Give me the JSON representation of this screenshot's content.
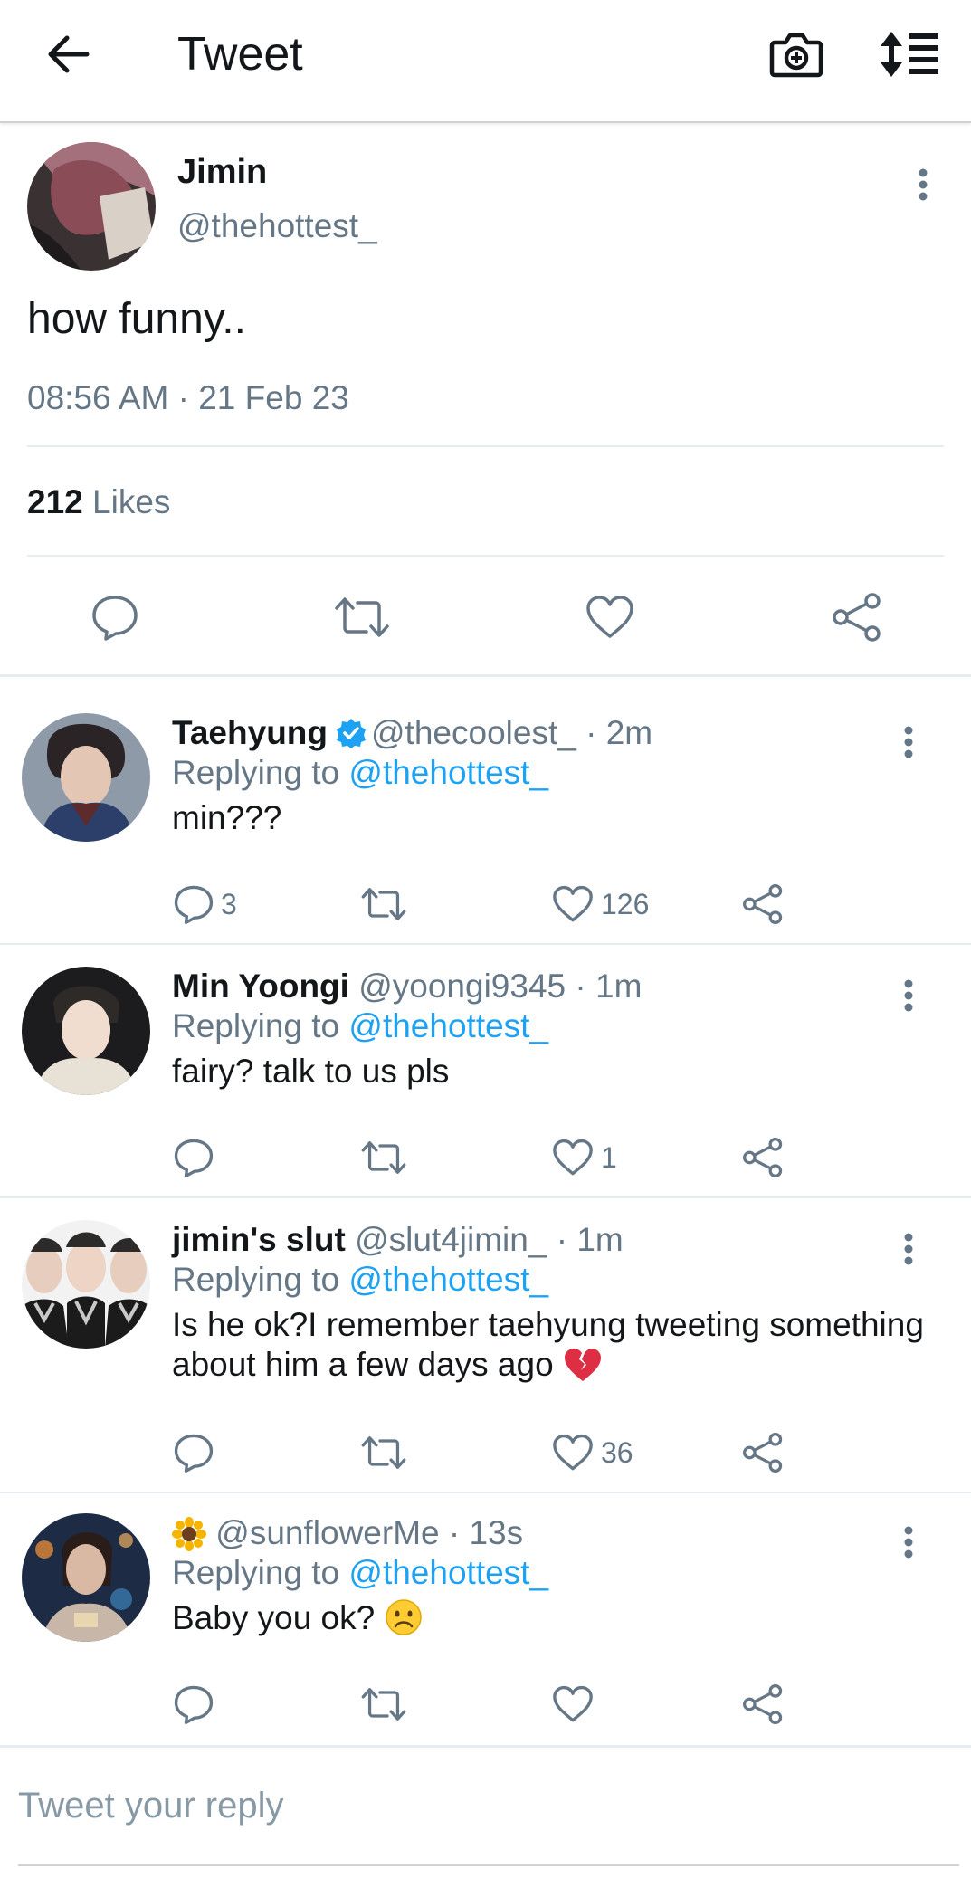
{
  "header": {
    "title": "Tweet",
    "back_icon": "arrow-left-icon",
    "camera_icon": "camera-add-icon",
    "sort_icon": "sort-list-icon"
  },
  "main_tweet": {
    "name": "Jimin",
    "handle": "@thehottest_",
    "text": "how funny..",
    "time": "08:56 AM",
    "date": "21 Feb 23",
    "meta_separator": " · ",
    "likes_count": "212",
    "likes_label": "Likes"
  },
  "replies": [
    {
      "name": "Taehyung",
      "verified": true,
      "handle": "@thecoolest_",
      "time": "2m",
      "replying_prefix": "Replying to",
      "replying_to": "@thehottest_",
      "text": "min???",
      "reply_count": "3",
      "retweet_count": "",
      "like_count": "126"
    },
    {
      "name": "Min Yoongi",
      "verified": false,
      "handle": "@yoongi9345",
      "time": "1m",
      "replying_prefix": "Replying to",
      "replying_to": "@thehottest_",
      "text": "fairy? talk to us pls",
      "reply_count": "",
      "retweet_count": "",
      "like_count": "1"
    },
    {
      "name": "jimin's slut",
      "verified": false,
      "handle": "@slut4jimin_",
      "time": "1m",
      "replying_prefix": "Replying to",
      "replying_to": "@thehottest_",
      "text": "Is he ok?I remember taehyung tweeting something about him a few days ago",
      "text_emoji": "broken-heart-emoji",
      "reply_count": "",
      "retweet_count": "",
      "like_count": "36"
    },
    {
      "name": "",
      "name_emoji": "sunflower-emoji",
      "verified": false,
      "handle": "@sunflowerMe",
      "time": "13s",
      "replying_prefix": "Replying to",
      "replying_to": "@thehottest_",
      "text": "Baby you ok?",
      "text_emoji": "frowning-face-emoji",
      "reply_count": "",
      "retweet_count": "",
      "like_count": ""
    }
  ],
  "reply_box": {
    "placeholder": "Tweet your reply"
  },
  "colors": {
    "accent": "#1da1f2",
    "text": "#14171a",
    "muted": "#657786",
    "divider": "#e6ecf0"
  }
}
